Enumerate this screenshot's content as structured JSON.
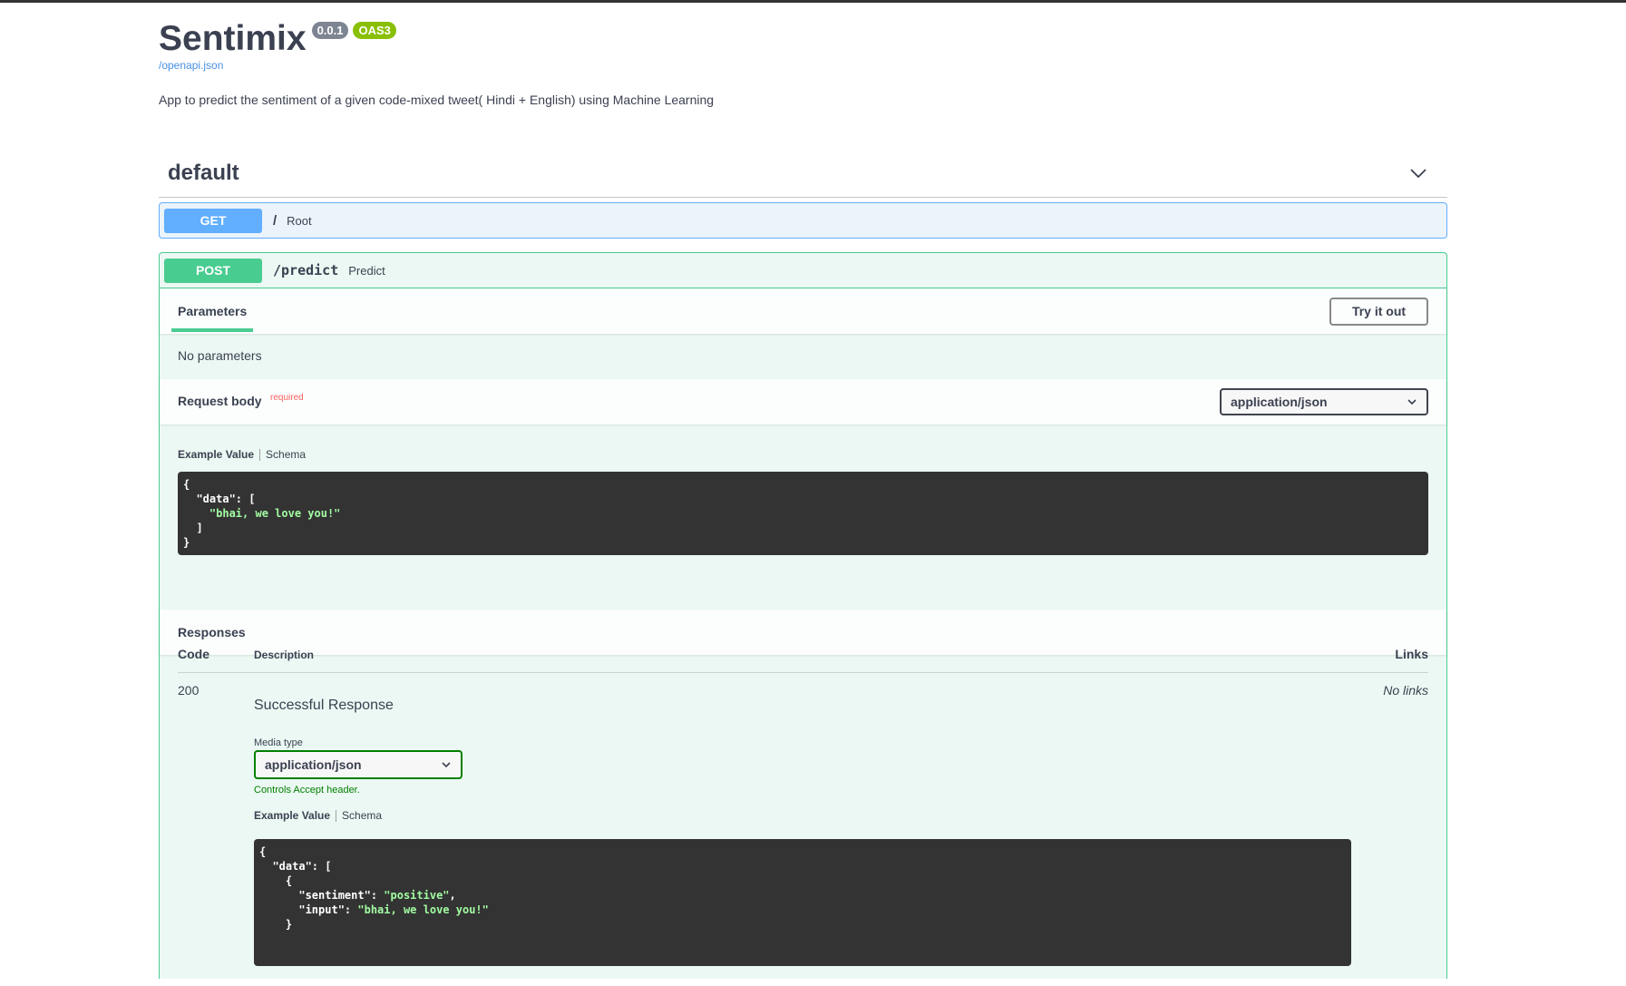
{
  "header": {
    "title": "Sentimix",
    "version_badge": "0.0.1",
    "oas_badge": "OAS3",
    "spec_link": "/openapi.json",
    "description": "App to predict the sentiment of a given code-mixed tweet( Hindi + English) using Machine Learning"
  },
  "section": {
    "name": "default",
    "toggle_icon": "chevron-down-icon"
  },
  "operations": {
    "get": {
      "method": "GET",
      "path": "/",
      "summary": "Root"
    },
    "post": {
      "method": "POST",
      "path": "/predict",
      "summary": "Predict"
    }
  },
  "parameters": {
    "tab_label": "Parameters",
    "try_button": "Try it out",
    "empty_text": "No parameters"
  },
  "request_body": {
    "title": "Request body",
    "required_label": "required",
    "content_type": "application/json",
    "example_tab": "Example Value",
    "schema_tab": "Schema",
    "example": {
      "line1": "{",
      "line2_key": "  \"data\": [",
      "line3_val": "    \"bhai, we love you!\"",
      "line4": "  ]",
      "line5": "}"
    }
  },
  "responses": {
    "title": "Responses",
    "col_code": "Code",
    "col_description": "Description",
    "col_links": "Links",
    "rows": [
      {
        "code": "200",
        "description": "Successful Response",
        "links": "No links",
        "media_type_label": "Media type",
        "media_type": "application/json",
        "controls_text": "Controls Accept header.",
        "example_tab": "Example Value",
        "schema_tab": "Schema",
        "example": {
          "l1": "{",
          "l2": "  \"data\": [",
          "l3": "    {",
          "l4_key": "      \"sentiment\": ",
          "l4_val": "\"positive\"",
          "l4_end": ",",
          "l5_key": "      \"input\": ",
          "l5_val": "\"bhai, we love you!\"",
          "l6": "    }"
        }
      }
    ]
  },
  "colors": {
    "get": "#61affe",
    "post": "#49cc90",
    "post_bg": "#ecf8f3",
    "get_bg": "#ebf3fb",
    "badge_version": "#7d8492",
    "badge_oas": "#89bf04",
    "link": "#4990e2",
    "required": "#ff6060",
    "code_bg": "#333333",
    "code_string": "#a2fca2"
  }
}
